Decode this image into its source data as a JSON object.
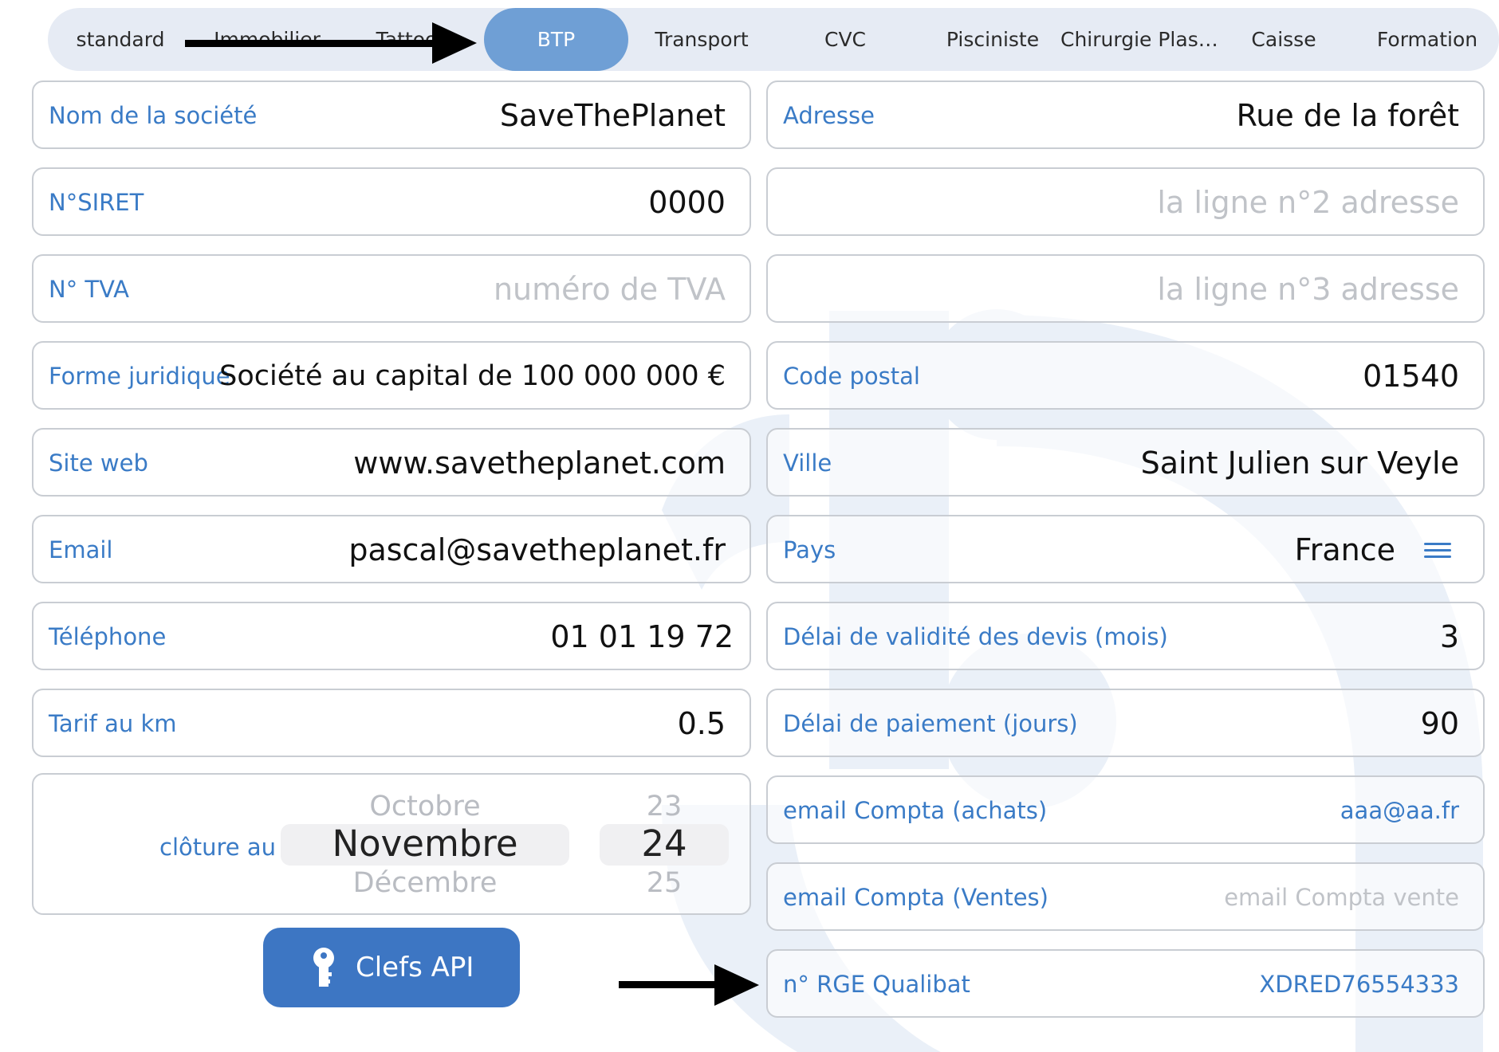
{
  "tabs": [
    {
      "label": "standard",
      "active": false
    },
    {
      "label": "Immobilier",
      "active": false
    },
    {
      "label": "Tattoo",
      "active": false
    },
    {
      "label": "BTP",
      "active": true
    },
    {
      "label": "Transport",
      "active": false
    },
    {
      "label": "CVC",
      "active": false
    },
    {
      "label": "Pisciniste",
      "active": false
    },
    {
      "label": "Chirurgie Plas…",
      "active": false
    },
    {
      "label": "Caisse",
      "active": false
    },
    {
      "label": "Formation",
      "active": false
    }
  ],
  "left_fields": [
    {
      "label": "Nom de la société",
      "value": "SaveThePlanet",
      "placeholder": ""
    },
    {
      "label": "N°SIRET",
      "value": "0000",
      "placeholder": ""
    },
    {
      "label": "N° TVA",
      "value": "",
      "placeholder": "numéro de TVA"
    },
    {
      "label": "Forme juridique",
      "value": "Société au capital de  100 000 000 €",
      "placeholder": ""
    },
    {
      "label": "Site web",
      "value": "www.savetheplanet.com",
      "placeholder": ""
    },
    {
      "label": "Email",
      "value": "pascal@savetheplanet.fr",
      "placeholder": ""
    },
    {
      "label": "Téléphone",
      "value": "01 01 19 72",
      "placeholder": ""
    },
    {
      "label": "Tarif au km",
      "value": "0.5",
      "placeholder": ""
    }
  ],
  "right_fields": [
    {
      "label": "Adresse",
      "value": "Rue de la forêt",
      "placeholder": ""
    },
    {
      "label": "",
      "value": "",
      "placeholder": "la ligne n°2 adresse"
    },
    {
      "label": "",
      "value": "",
      "placeholder": "la ligne n°3 adresse"
    },
    {
      "label": "Code postal",
      "value": "01540",
      "placeholder": ""
    },
    {
      "label": "Ville",
      "value": "Saint Julien sur Veyle",
      "placeholder": ""
    },
    {
      "label": "Pays",
      "value": "France",
      "placeholder": ""
    },
    {
      "label": "Délai de validité des devis (mois)",
      "value": "3",
      "placeholder": ""
    },
    {
      "label": "Délai de paiement (jours)",
      "value": "90",
      "placeholder": ""
    },
    {
      "label": "email Compta (achats)",
      "value": "aaa@aa.fr",
      "placeholder": ""
    },
    {
      "label": "email Compta (Ventes)",
      "value": "",
      "placeholder": "email Compta vente"
    },
    {
      "label": "n° RGE Qualibat",
      "value": "XDRED76554333",
      "placeholder": ""
    }
  ],
  "closing_date": {
    "label": "clôture au",
    "months": {
      "prev": "Octobre",
      "current": "Novembre",
      "next": "Décembre"
    },
    "days": {
      "prev": "23",
      "current": "24",
      "next": "25"
    }
  },
  "api_button": {
    "label": "Clefs API"
  },
  "icons": {
    "menu": "hamburger-menu-icon",
    "key": "key-icon",
    "arrow": "arrow-right-icon"
  },
  "colors": {
    "accent": "#3a7bc6",
    "active_tab": "#6f9fd5",
    "button": "#3d76c3",
    "watermark": "#eaf0f8"
  }
}
